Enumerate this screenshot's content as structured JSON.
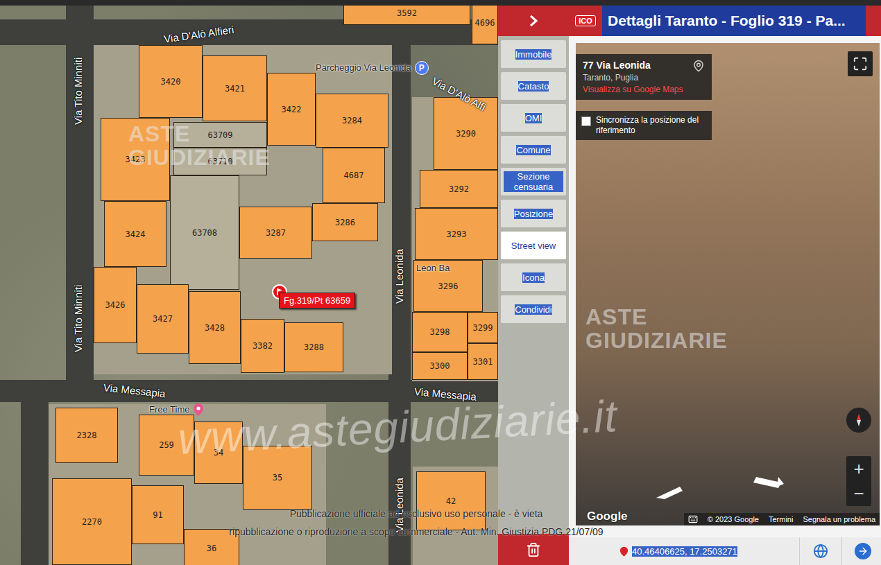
{
  "header": {
    "badge": "ICO",
    "title": "Dettagli Taranto - Foglio 319 - Pa..."
  },
  "map": {
    "parcels": [
      {
        "label": "3592",
        "kind": "building"
      },
      {
        "label": "4696",
        "kind": "building"
      },
      {
        "label": "3420",
        "kind": "building"
      },
      {
        "label": "3421",
        "kind": "building"
      },
      {
        "label": "3422",
        "kind": "building"
      },
      {
        "label": "3284",
        "kind": "building"
      },
      {
        "label": "63709",
        "kind": "courtyard"
      },
      {
        "label": "63710",
        "kind": "courtyard"
      },
      {
        "label": "3423",
        "kind": "building"
      },
      {
        "label": "4687",
        "kind": "building"
      },
      {
        "label": "3286",
        "kind": "building"
      },
      {
        "label": "3287",
        "kind": "building"
      },
      {
        "label": "63708",
        "kind": "courtyard"
      },
      {
        "label": "3424",
        "kind": "building"
      },
      {
        "label": "3426",
        "kind": "building"
      },
      {
        "label": "3427",
        "kind": "building"
      },
      {
        "label": "3428",
        "kind": "building"
      },
      {
        "label": "3382",
        "kind": "building"
      },
      {
        "label": "3288",
        "kind": "building"
      },
      {
        "label": "3290",
        "kind": "building"
      },
      {
        "label": "3292",
        "kind": "building"
      },
      {
        "label": "3293",
        "kind": "building"
      },
      {
        "label": "3296",
        "kind": "building"
      },
      {
        "label": "3298",
        "kind": "building"
      },
      {
        "label": "3299",
        "kind": "building"
      },
      {
        "label": "3301",
        "kind": "building"
      },
      {
        "label": "3300",
        "kind": "building"
      },
      {
        "label": "2328",
        "kind": "building"
      },
      {
        "label": "259",
        "kind": "building"
      },
      {
        "label": "34",
        "kind": "building"
      },
      {
        "label": "35",
        "kind": "building"
      },
      {
        "label": "2270",
        "kind": "building"
      },
      {
        "label": "91",
        "kind": "building"
      },
      {
        "label": "36",
        "kind": "building"
      },
      {
        "label": "42",
        "kind": "building"
      }
    ],
    "streets": [
      {
        "label": "Via D'Alò Alfieri"
      },
      {
        "label": "Via D'Alò Alfi"
      },
      {
        "label": "Via Tito Minniti"
      },
      {
        "label": "Via Tito Minniti"
      },
      {
        "label": "Via Leonida"
      },
      {
        "label": "Via Leonida"
      },
      {
        "label": "Via Messapia"
      },
      {
        "label": "Via Messapia"
      }
    ],
    "places": [
      {
        "label": "Parcheggio Via Leonida",
        "kind": "parking",
        "icon": "P"
      },
      {
        "label": "Free Time",
        "kind": "pin",
        "icon": ""
      },
      {
        "label": "Leon Ba",
        "kind": "text",
        "icon": ""
      }
    ],
    "marker": {
      "label": "Fg.319/Pt 63659"
    },
    "stamp": {
      "lines": [
        "ASTE",
        "GIUDIZIARIE"
      ]
    }
  },
  "menu": {
    "items": [
      {
        "label": "Immobile",
        "selected": false,
        "highlighted": true
      },
      {
        "label": "Catasto",
        "selected": false,
        "highlighted": true
      },
      {
        "label": "OMI",
        "selected": false,
        "highlighted": true
      },
      {
        "label": "Comune",
        "selected": false,
        "highlighted": true
      },
      {
        "label": "Sezione censuaria",
        "selected": false,
        "highlighted": true
      },
      {
        "label": "Posizione",
        "selected": false,
        "highlighted": true
      },
      {
        "label": "Street view",
        "selected": true,
        "highlighted": false
      },
      {
        "label": "Icona",
        "selected": false,
        "highlighted": true
      },
      {
        "label": "Condividi",
        "selected": false,
        "highlighted": true
      }
    ]
  },
  "street_view": {
    "address": "77 Via Leonida",
    "city": "Taranto, Puglia",
    "link": "Visualizza su Google Maps",
    "sync": {
      "label": "Sincronizza la posizione del riferimento",
      "checked": false
    },
    "logo": "Google",
    "attribution": [
      "© 2023 Google",
      "Termini",
      "Segnala un problema"
    ],
    "zoom_in": "+",
    "zoom_out": "−",
    "stamp": {
      "lines": [
        "ASTE",
        "GIUDIZIARIE"
      ]
    }
  },
  "location": {
    "coordinates": "40.46406625, 17.2503271",
    "highlighted": true
  },
  "watermark": {
    "url": "www.astegiudiziarie.it",
    "notice": [
      "Pubblicazione ufficiale ad esclusivo uso personale - è vieta",
      "ripubblicazione o riproduzione a scopo commerciale - Aut. Min. Giustizia PDG 21/07/09"
    ]
  }
}
